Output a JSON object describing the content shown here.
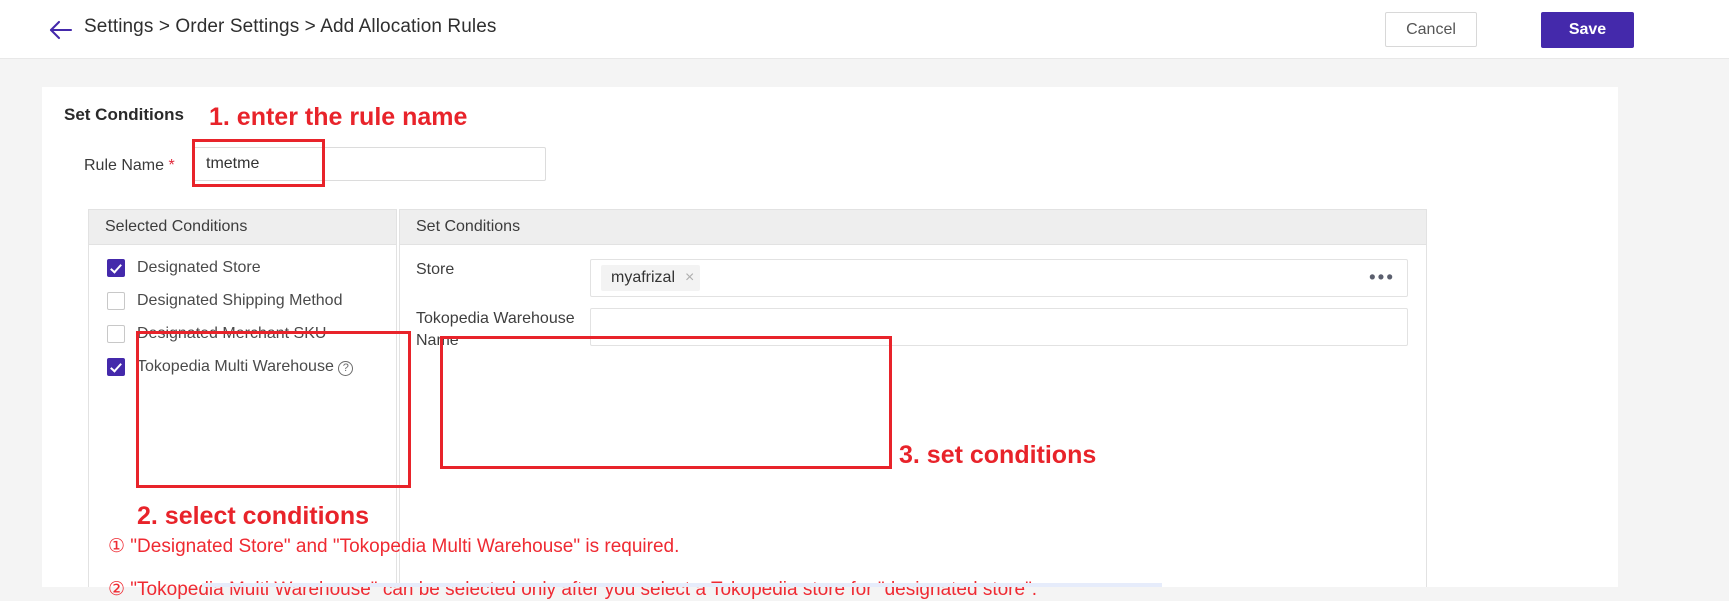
{
  "header": {
    "back_icon": "arrow-left-icon",
    "breadcrumb": "Settings > Order Settings > Add Allocation Rules",
    "cancel_label": "Cancel",
    "save_label": "Save"
  },
  "colors": {
    "accent_purple": "#4429ab",
    "annotation_red": "#e8232a",
    "panel_header_gray": "#eeeeee",
    "page_background": "#f4f4f4"
  },
  "card": {
    "title": "Set Conditions",
    "rule_name": {
      "label": "Rule Name",
      "required_marker": "*",
      "value": "tmetme",
      "placeholder": ""
    }
  },
  "selected_conditions": {
    "header": "Selected Conditions",
    "items": [
      {
        "label": "Designated Store",
        "checked": true,
        "help": false
      },
      {
        "label": "Designated Shipping Method",
        "checked": false,
        "help": false
      },
      {
        "label": "Designated Merchant SKU",
        "checked": false,
        "help": false
      },
      {
        "label": "Tokopedia Multi Warehouse",
        "checked": true,
        "help": true
      }
    ],
    "help_icon_glyph": "?"
  },
  "set_conditions": {
    "header": "Set Conditions",
    "rows": [
      {
        "label": "Store",
        "chips": [
          "myafrizal"
        ],
        "chip_remove_glyph": "×",
        "has_ellipsis": true,
        "ellipsis_glyph": "•••",
        "value": ""
      },
      {
        "label": "Tokopedia Warehouse Name",
        "chips": [],
        "has_ellipsis": false,
        "value": "",
        "placeholder": ""
      }
    ]
  },
  "annotations": {
    "step1": "1. enter the rule name",
    "step2": "2. select conditions",
    "step3": "3. set conditions",
    "note1": "① \"Designated Store\" and \"Tokopedia Multi Warehouse\" is required.",
    "note2": "② \"Tokopedia Multi Warehouse\" can be selected only after you select a Tokopedia store for \"designated store\"."
  }
}
